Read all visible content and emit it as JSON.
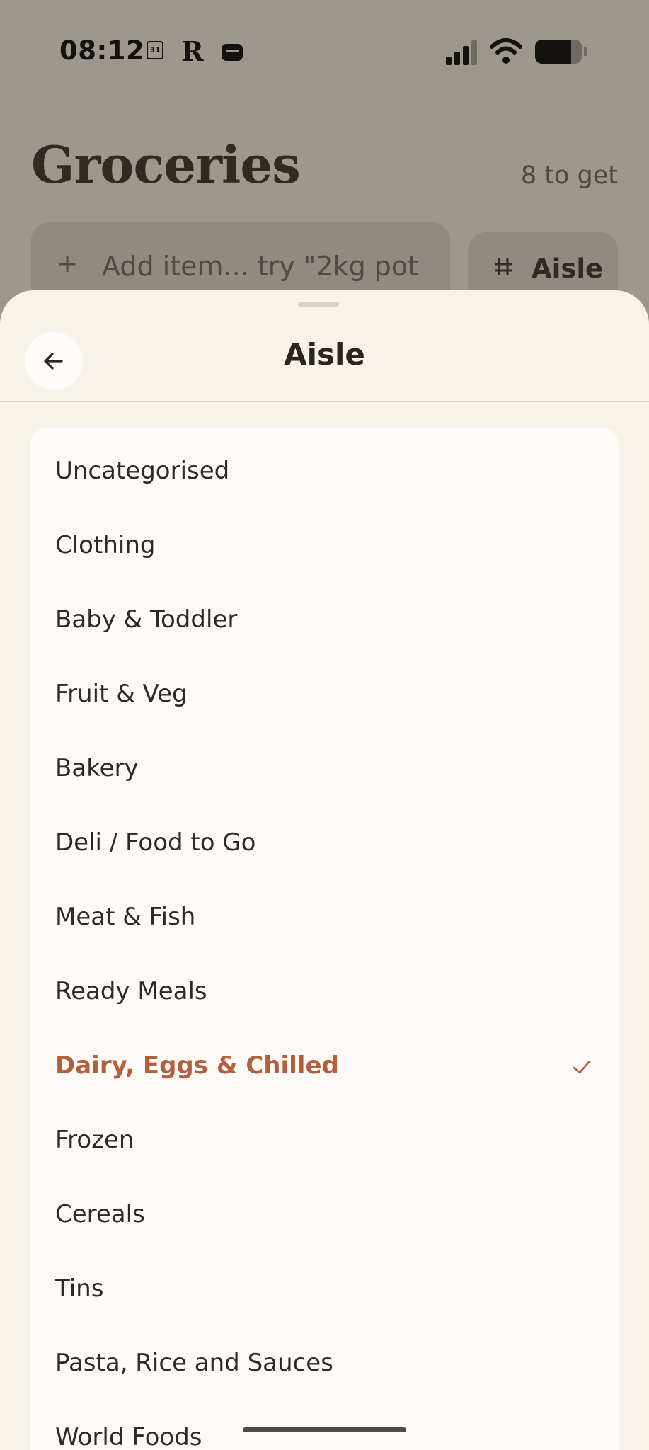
{
  "status_bar": {
    "time": "08:12",
    "calendar_day": "31",
    "r_badge": "R",
    "battery_level": 0.78
  },
  "groceries": {
    "title": "Groceries",
    "count_label": "8 to get",
    "add_placeholder": "Add item... try \"2kg pot",
    "aisle_button_label": "Aisle",
    "aisle_button_icon": "grid-icon"
  },
  "sheet": {
    "title": "Aisle",
    "back_icon": "arrow-left-icon",
    "aisles": [
      {
        "label": "Uncategorised",
        "selected": false
      },
      {
        "label": "Clothing",
        "selected": false
      },
      {
        "label": "Baby & Toddler",
        "selected": false
      },
      {
        "label": "Fruit & Veg",
        "selected": false
      },
      {
        "label": "Bakery",
        "selected": false
      },
      {
        "label": "Deli / Food to Go",
        "selected": false
      },
      {
        "label": "Meat & Fish",
        "selected": false
      },
      {
        "label": "Ready Meals",
        "selected": false
      },
      {
        "label": "Dairy, Eggs & Chilled",
        "selected": true
      },
      {
        "label": "Frozen",
        "selected": false
      },
      {
        "label": "Cereals",
        "selected": false
      },
      {
        "label": "Tins",
        "selected": false
      },
      {
        "label": "Pasta, Rice and Sauces",
        "selected": false
      },
      {
        "label": "World Foods",
        "selected": false
      }
    ],
    "selected_icon": "checkmark-icon"
  },
  "colors": {
    "accent": "#b55e3e",
    "sheet_bg": "#f7f2ea",
    "card_bg": "#fdfbf7",
    "scrim": "#9d978d"
  }
}
